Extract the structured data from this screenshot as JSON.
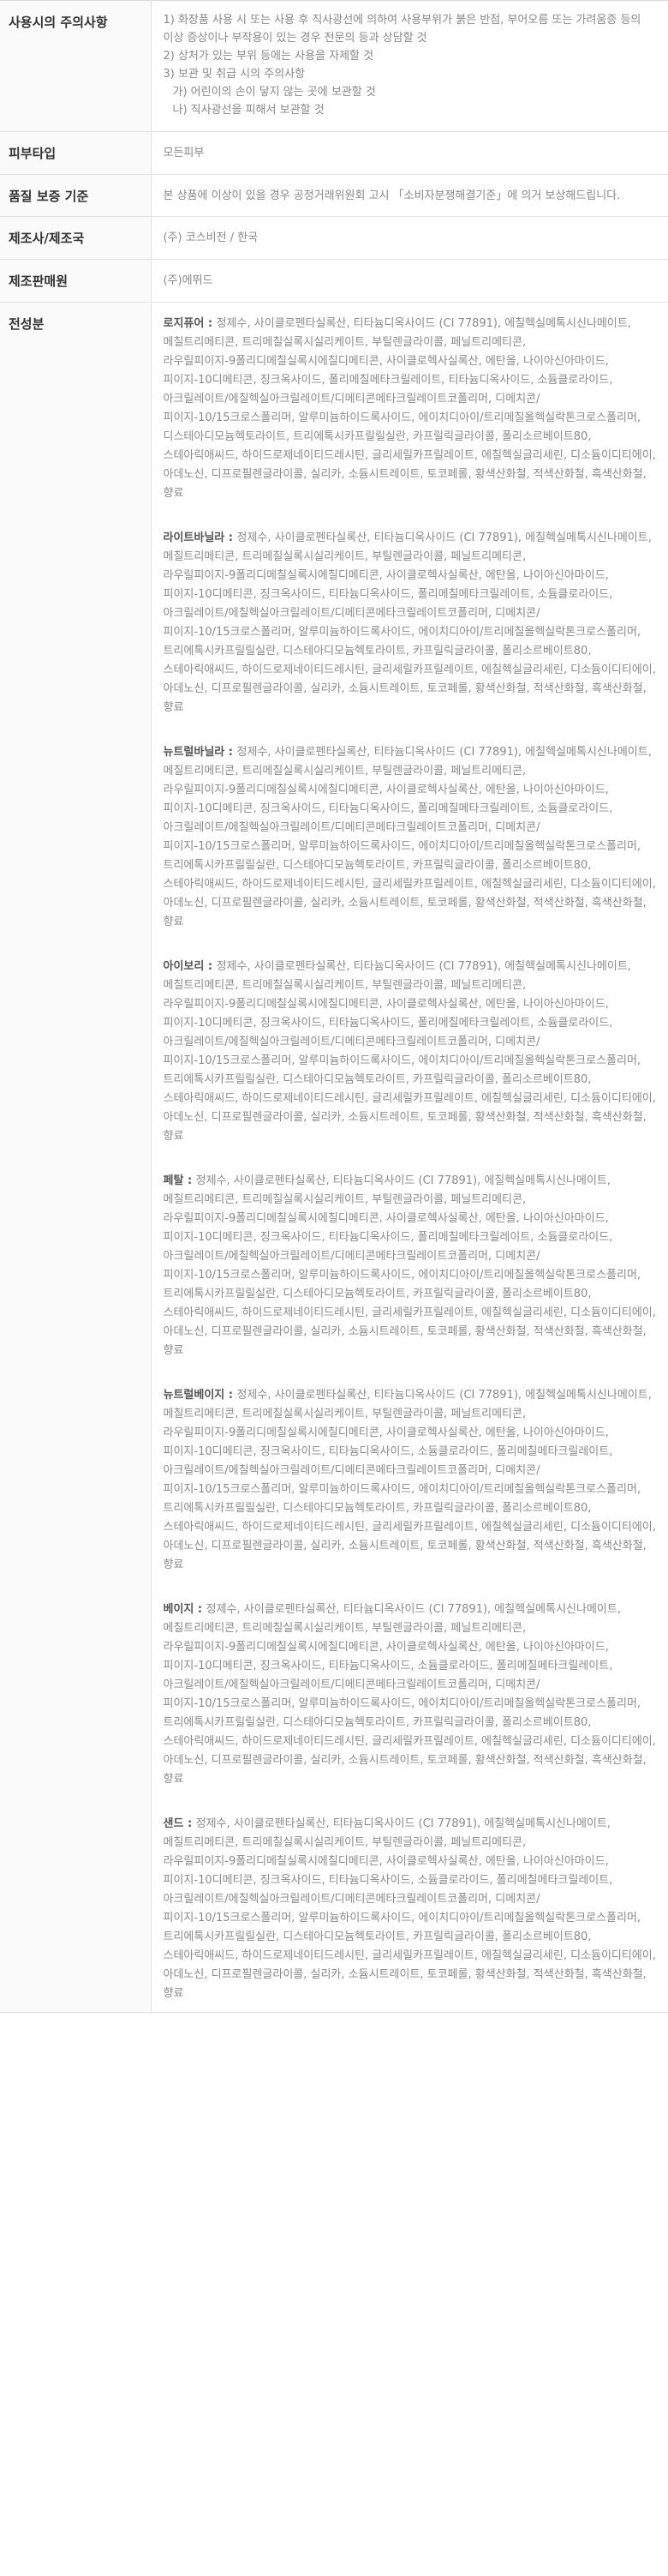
{
  "caution": {
    "label": "사용시의 주의사항",
    "lines": [
      "1) 화장품 사용 시 또는 사용 후 직사광선에 의하여 사용부위가 붉은 반점, 부어오름 또는 가려움증 등의 이상 증상이나 부작용이 있는 경우 전문의 등과 상담할 것",
      "2) 상처가 있는 부위 등에는 사용을 자제할 것",
      "3) 보관 및 취급 시의 주의사항",
      "가) 어린이의 손이 닿지 않는 곳에 보관할 것",
      "나) 직사광선을 피해서 보관할 것"
    ]
  },
  "skin_type": {
    "label": "피부타입",
    "value": "모든피부"
  },
  "quality": {
    "label": "품질 보증 기준",
    "value": "본 상품에 이상이 있을 경우 공정거래위원회 고시 「소비자분쟁해결기준」에 의거 보상해드립니다."
  },
  "manufacturer": {
    "label": "제조사/제조국",
    "value": "(주) 코스비전 / 한국"
  },
  "seller": {
    "label": "제조판매원",
    "value": "(주)에뛰드"
  },
  "ingredients": {
    "label": "전성분",
    "shades": [
      {
        "name": "로지퓨어 : ",
        "text": "정제수, 사이클로펜타실록산, 티타늄디옥사이드 (CI 77891), 에칠헥실메톡시신나메이트, 메칠트리메티콘, 트리메칠실록시실리케이트, 부틸렌글라이콜, 페닐트리메티콘, 라우릴피이지-9폴리디메칠실록시에칠디메티콘, 사이클로헥사실록산, 에탄올, 나이아신아마이드, 피이지-10디메티콘, 징크옥사이드, 폴리메칠메타크릴레이트, 티타늄디옥사이드, 소듐클로라이드, 아크릴레이트/에칠헥실아크릴레이트/디메티콘메타크릴레이트코폴리머, 디메치콘/피이지-10/15크로스폴리머, 알루미늄하이드록사이드, 에이치디아이/트리메칠올헥실락톤크로스폴리머, 디스테아디모늄헥토라이트, 트리에톡시카프릴릴실란, 카프릴릭글라이콜, 폴리소르베이트80, 스테아릭애씨드, 하이드로제네이티드레시틴, 글리세릴카프릴레이트, 에칠헥실글리세린, 디소듐이디티에이, 아데노신, 디프로필렌글라이콜, 실리카, 소듐시트레이트, 토코페롤, 황색산화철, 적색산화철, 흑색산화철, 향료"
      },
      {
        "name": "라이트바닐라 : ",
        "text": "정제수, 사이클로펜타실록산, 티타늄디옥사이드 (CI 77891), 에칠헥실메톡시신나메이트, 메칠트리메티콘, 트리메칠실록시실리케이트, 부틸렌글라이콜, 페닐트리메티콘, 라우릴피이지-9폴리디메칠실록시에칠디메티콘, 사이클로헥사실록산, 에탄올, 나이아신아마이드, 피이지-10디메티콘, 징크옥사이드, 티타늄디옥사이드, 폴리메칠메타크릴레이트, 소듐클로라이드, 아크릴레이트/에칠헥실아크릴레이트/디메티콘메타크릴레이트코폴리머, 디메치콘/피이지-10/15크로스폴리머, 알루미늄하이드록사이드, 에이치디아이/트리메칠올헥실락톤크로스폴리머, 트리에톡시카프릴릴실란, 디스테아디모늄헥토라이트, 카프릴릭글라이콜, 폴리소르베이트80, 스테아릭애씨드, 하이드로제네이티드레시틴, 글리세릴카프릴레이트, 에칠헥실글리세린, 디소듐이디티에이, 아데노신, 디프로필렌글라이콜, 실리카, 소듐시트레이트, 토코페롤, 황색산화철, 적색산화철, 흑색산화철, 향료"
      },
      {
        "name": "뉴트럴바닐라 : ",
        "text": "정제수, 사이클로펜타실록산, 티타늄디옥사이드 (CI 77891), 에칠헥실메톡시신나메이트, 메칠트리메티콘, 트리메칠실록시실리케이트, 부틸렌글라이콜, 페닐트리메티콘, 라우릴피이지-9폴리디메칠실록시에칠디메티콘, 사이클로헥사실록산, 에탄올, 나이아신아마이드, 피이지-10디메티콘, 징크옥사이드, 티타늄디옥사이드, 폴리메칠메타크릴레이트, 소듐클로라이드, 아크릴레이트/에칠헥실아크릴레이트/디메티콘메타크릴레이트코폴리머, 디메치콘/피이지-10/15크로스폴리머, 알루미늄하이드록사이드, 에이치디아이/트리메칠올헥실락톤크로스폴리머, 트리에톡시카프릴릴실란, 디스테아디모늄헥토라이트, 카프릴릭글라이콜, 폴리소르베이트80, 스테아릭애씨드, 하이드로제네이티드레시틴, 글리세릴카프릴레이트, 에칠헥실글리세린, 디소듐이디티에이, 아데노신, 디프로필렌글라이콜, 실리카, 소듐시트레이트, 토코페롤, 황색산화철, 적색산화철, 흑색산화철, 향료"
      },
      {
        "name": "아이보리 : ",
        "text": "정제수, 사이클로펜타실록산, 티타늄디옥사이드 (CI 77891), 에칠헥실메톡시신나메이트, 메칠트리메티콘, 트리메칠실록시실리케이트, 부틸렌글라이콜, 페닐트리메티콘, 라우릴피이지-9폴리디메칠실록시에칠디메티콘, 사이클로헥사실록산, 에탄올, 나이아신아마이드, 피이지-10디메티콘, 징크옥사이드, 티타늄디옥사이드, 폴리메칠메타크릴레이트, 소듐클로라이드, 아크릴레이트/에칠헥실아크릴레이트/디메티콘메타크릴레이트코폴리머, 디메치콘/피이지-10/15크로스폴리머, 알루미늄하이드록사이드, 에이치디아이/트리메칠올헥실락톤크로스폴리머, 트리에톡시카프릴릴실란, 디스테아디모늄헥토라이트, 카프릴릭글라이콜, 폴리소르베이트80, 스테아릭애씨드, 하이드로제네이티드레시틴, 글리세릴카프릴레이트, 에칠헥실글리세린, 디소듐이디티에이, 아데노신, 디프로필렌글라이콜, 실리카, 소듐시트레이트, 토코페롤, 황색산화철, 적색산화철, 흑색산화철, 향료"
      },
      {
        "name": "페탈 : ",
        "text": "정제수, 사이클로펜타실록산, 티타늄디옥사이드 (CI 77891), 에칠헥실메톡시신나메이트, 메칠트리메티콘, 트리메칠실록시실리케이트, 부틸렌글라이콜, 페닐트리메티콘, 라우릴피이지-9폴리디메칠실록시에칠디메티콘, 사이클로헥사실록산, 에탄올, 나이아신아마이드, 피이지-10디메티콘, 징크옥사이드, 티타늄디옥사이드, 폴리메칠메타크릴레이트, 소듐클로라이드, 아크릴레이트/에칠헥실아크릴레이트/디메티콘메타크릴레이트코폴리머, 디메치콘/피이지-10/15크로스폴리머, 알루미늄하이드록사이드, 에이치디아이/트리메칠올헥실락톤크로스폴리머, 트리에톡시카프릴릴실란, 디스테아디모늄헥토라이트, 카프릴릭글라이콜, 폴리소르베이트80, 스테아릭애씨드, 하이드로제네이티드레시틴, 글리세릴카프릴레이트, 에칠헥실글리세린, 디소듐이디티에이, 아데노신, 디프로필렌글라이콜, 실리카, 소듐시트레이트, 토코페롤, 황색산화철, 적색산화철, 흑색산화철, 향료"
      },
      {
        "name": "뉴트럴베이지 : ",
        "text": "정제수, 사이클로펜타실록산, 티타늄디옥사이드 (CI 77891), 에칠헥실메톡시신나메이트, 메칠트리메티콘, 트리메칠실록시실리케이트, 부틸렌글라이콜, 페닐트리메티콘, 라우릴피이지-9폴리디메칠실록시에칠디메티콘, 사이클로헥사실록산, 에탄올, 나이아신아마이드, 피이지-10디메티콘, 징크옥사이드, 티타늄디옥사이드, 소듐클로라이드, 폴리메칠메타크릴레이트, 아크릴레이트/에칠헥실아크릴레이트/디메티콘메타크릴레이트코폴리머, 디메치콘/피이지-10/15크로스폴리머, 알루미늄하이드록사이드, 에이치디아이/트리메칠올헥실락톤크로스폴리머, 트리에톡시카프릴릴실란, 디스테아디모늄헥토라이트, 카프릴릭글라이콜, 폴리소르베이트80, 스테아릭애씨드, 하이드로제네이티드레시틴, 글리세릴카프릴레이트, 에칠헥실글리세린, 디소듐이디티에이, 아데노신, 디프로필렌글라이콜, 실리카, 소듐시트레이트, 토코페롤, 황색산화철, 적색산화철, 흑색산화철, 향료"
      },
      {
        "name": "베이지 : ",
        "text": "정제수, 사이클로펜타실록산, 티타늄디옥사이드 (CI 77891), 에칠헥실메톡시신나메이트, 메칠트리메티콘, 트리메칠실록시실리케이트, 부틸렌글라이콜, 페닐트리메티콘, 라우릴피이지-9폴리디메칠실록시에칠디메티콘, 사이클로헥사실록산, 에탄올, 나이아신아마이드, 피이지-10디메티콘, 징크옥사이드, 티타늄디옥사이드, 소듐클로라이드, 폴리메칠메타크릴레이트, 아크릴레이트/에칠헥실아크릴레이트/디메티콘메타크릴레이트코폴리머, 디메치콘/피이지-10/15크로스폴리머, 알루미늄하이드록사이드, 에이치디아이/트리메칠올헥실락톤크로스폴리머, 트리에톡시카프릴릴실란, 디스테아디모늄헥토라이트, 카프릴릭글라이콜, 폴리소르베이트80, 스테아릭애씨드, 하이드로제네이티드레시틴, 글리세릴카프릴레이트, 에칠헥실글리세린, 디소듐이디티에이, 아데노신, 디프로필렌글라이콜, 실리카, 소듐시트레이트, 토코페롤, 황색산화철, 적색산화철, 흑색산화철, 향료"
      },
      {
        "name": "샌드 : ",
        "text": "정제수, 사이클로펜타실록산, 티타늄디옥사이드 (CI 77891), 에칠헥실메톡시신나메이트, 메칠트리메티콘, 트리메칠실록시실리케이트, 부틸렌글라이콜, 페닐트리메티콘, 라우릴피이지-9폴리디메칠실록시에칠디메티콘, 사이클로헥사실록산, 에탄올, 나이아신아마이드, 피이지-10디메티콘, 징크옥사이드, 티타늄디옥사이드, 소듐클로라이드, 폴리메칠메타크릴레이트, 아크릴레이트/에칠헥실아크릴레이트/디메티콘메타크릴레이트코폴리머, 디메치콘/피이지-10/15크로스폴리머, 알루미늄하이드록사이드, 에이치디아이/트리메칠올헥실락톤크로스폴리머, 트리에톡시카프릴릴실란, 디스테아디모늄헥토라이트, 카프릴릭글라이콜, 폴리소르베이트80, 스테아릭애씨드, 하이드로제네이티드레시틴, 글리세릴카프릴레이트, 에칠헥실글리세린, 디소듐이디티에이, 아데노신, 디프로필렌글라이콜, 실리카, 소듐시트레이트, 토코페롤, 황색산화철, 적색산화철, 흑색산화철, 향료"
      }
    ]
  }
}
